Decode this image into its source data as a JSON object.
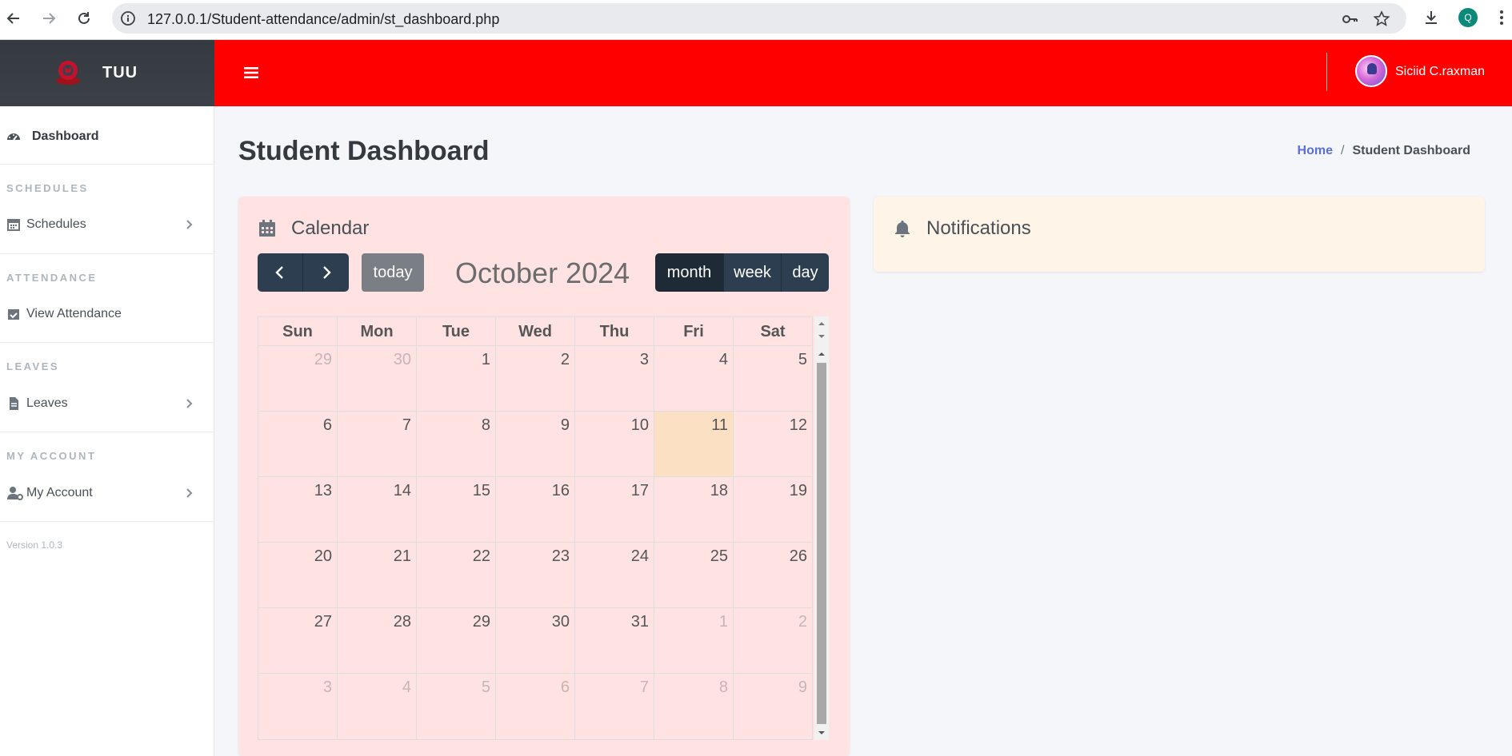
{
  "browser": {
    "url": "127.0.0.1/Student-attendance/admin/st_dashboard.php",
    "profile_initial": "Q"
  },
  "brand": {
    "name": "TUU"
  },
  "topbar": {
    "username": "Siciid C.raxman"
  },
  "sidebar": {
    "dashboard": "Dashboard",
    "sections": [
      {
        "header": "SCHEDULES",
        "item": "Schedules"
      },
      {
        "header": "ATTENDANCE",
        "item": "View Attendance"
      },
      {
        "header": "LEAVES",
        "item": "Leaves"
      },
      {
        "header": "MY ACCOUNT",
        "item": "My Account"
      }
    ],
    "version": "Version 1.0.3"
  },
  "page": {
    "title": "Student Dashboard",
    "breadcrumb": {
      "home": "Home",
      "separator": "/",
      "current": "Student Dashboard"
    }
  },
  "calendar": {
    "card_title": "Calendar",
    "today_label": "today",
    "month_title": "October 2024",
    "views": [
      "month",
      "week",
      "day"
    ],
    "active_view": "month",
    "weekdays": [
      "Sun",
      "Mon",
      "Tue",
      "Wed",
      "Thu",
      "Fri",
      "Sat"
    ],
    "weeks": [
      [
        {
          "d": "29",
          "o": true
        },
        {
          "d": "30",
          "o": true
        },
        {
          "d": "1"
        },
        {
          "d": "2"
        },
        {
          "d": "3"
        },
        {
          "d": "4"
        },
        {
          "d": "5"
        }
      ],
      [
        {
          "d": "6"
        },
        {
          "d": "7"
        },
        {
          "d": "8"
        },
        {
          "d": "9"
        },
        {
          "d": "10"
        },
        {
          "d": "11",
          "t": true
        },
        {
          "d": "12"
        }
      ],
      [
        {
          "d": "13"
        },
        {
          "d": "14"
        },
        {
          "d": "15"
        },
        {
          "d": "16"
        },
        {
          "d": "17"
        },
        {
          "d": "18"
        },
        {
          "d": "19"
        }
      ],
      [
        {
          "d": "20"
        },
        {
          "d": "21"
        },
        {
          "d": "22"
        },
        {
          "d": "23"
        },
        {
          "d": "24"
        },
        {
          "d": "25"
        },
        {
          "d": "26"
        }
      ],
      [
        {
          "d": "27"
        },
        {
          "d": "28"
        },
        {
          "d": "29"
        },
        {
          "d": "30"
        },
        {
          "d": "31"
        },
        {
          "d": "1",
          "o": true
        },
        {
          "d": "2",
          "o": true
        }
      ],
      [
        {
          "d": "3",
          "o": true
        },
        {
          "d": "4",
          "o": true
        },
        {
          "d": "5",
          "o": true
        },
        {
          "d": "6",
          "o": true
        },
        {
          "d": "7",
          "o": true
        },
        {
          "d": "8",
          "o": true
        },
        {
          "d": "9",
          "o": true
        }
      ]
    ]
  },
  "notifications": {
    "card_title": "Notifications"
  },
  "colors": {
    "topbar": "#ff0000",
    "calendar_card": "#ffe3e3",
    "notifications_card": "#fff4e8",
    "today_cell": "#fce0c4"
  }
}
